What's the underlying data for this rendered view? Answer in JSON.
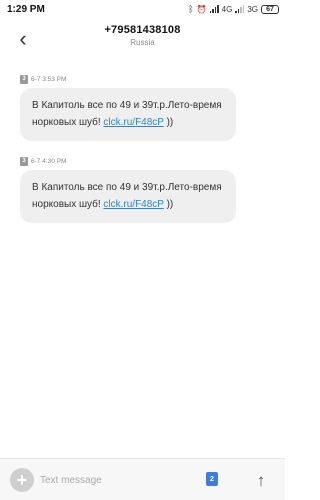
{
  "status_bar": {
    "time": "1:29 PM",
    "network_1": "4G",
    "network_2": "3G",
    "battery": "67"
  },
  "header": {
    "contact_number": "+79581438108",
    "contact_country": "Russia"
  },
  "messages": [
    {
      "sim": "3",
      "timestamp": "6-7 3:53 PM",
      "text": "В Капитоль все по 49 и 39т.р.Лето-время норковых шуб! ",
      "link": "clck.ru/F48cP",
      "suffix": " ))"
    },
    {
      "sim": "3",
      "timestamp": "6-7 4:30 PM",
      "text": "В Капитоль все по 49 и 39т.р.Лето-время норковых шуб! ",
      "link": "clck.ru/F48cP",
      "suffix": " ))"
    }
  ],
  "composer": {
    "placeholder": "Text message",
    "sim_slot": "2"
  },
  "icons": {
    "back": "back-arrow-icon",
    "add": "plus-icon",
    "send": "send-arrow-icon",
    "bluetooth": "bluetooth-icon",
    "alarm": "alarm-icon"
  },
  "colors": {
    "link": "#2a86d3",
    "bubble": "#efefef",
    "sim_badge": "#3f7dd9"
  }
}
